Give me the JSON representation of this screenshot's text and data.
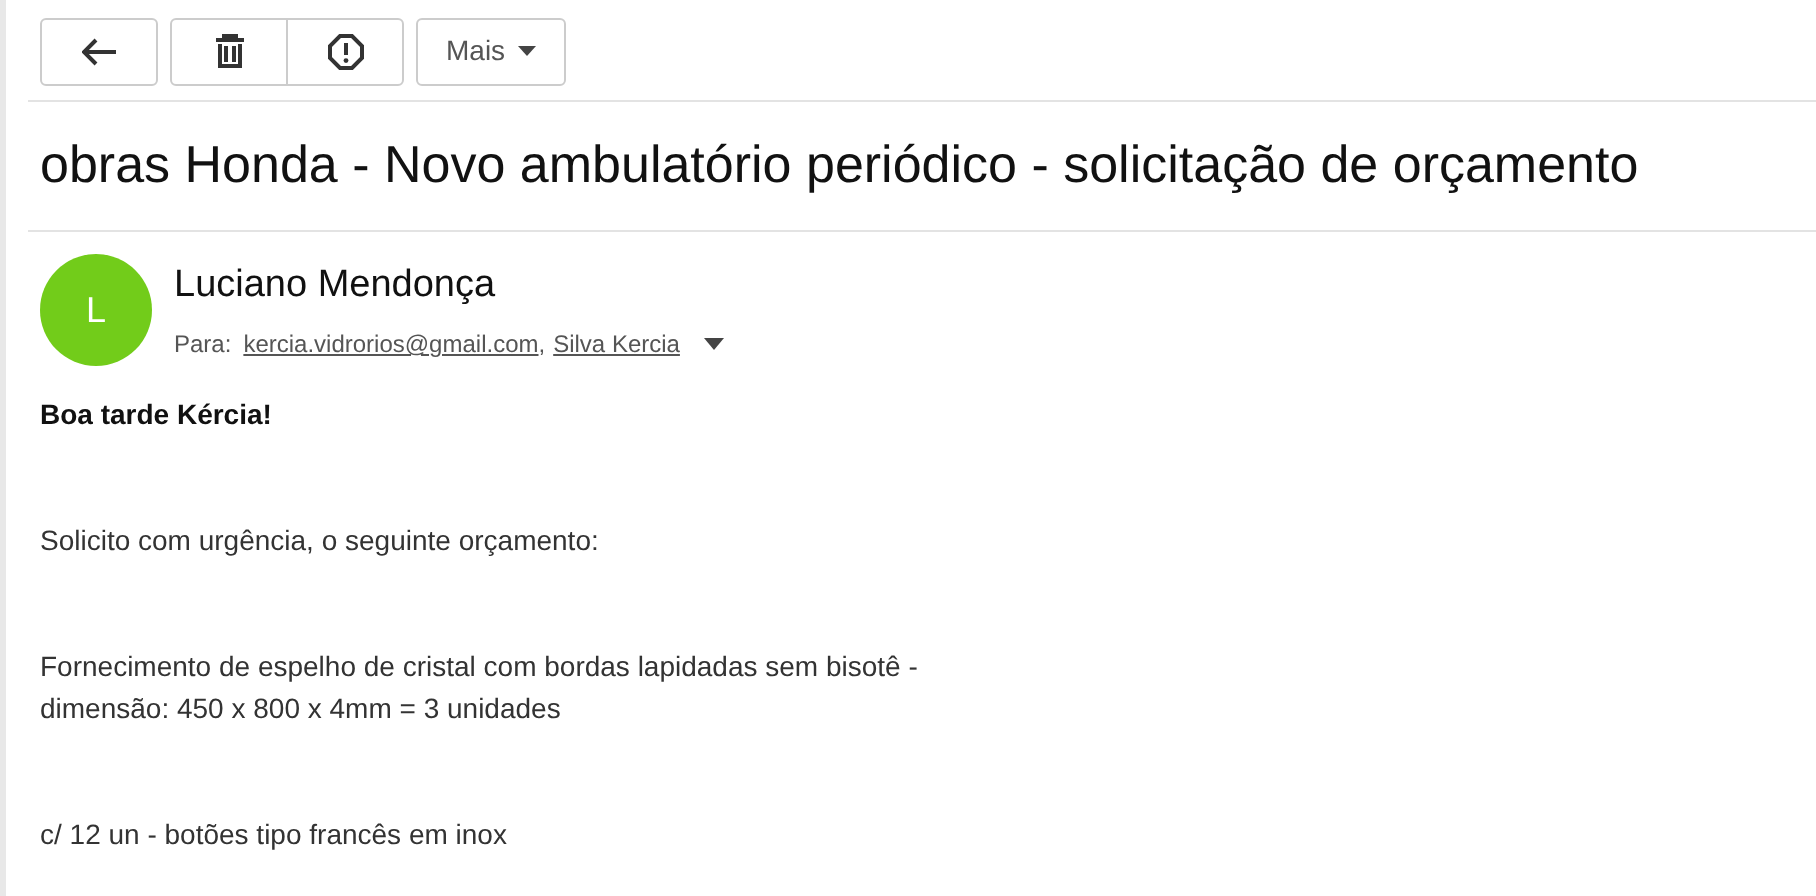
{
  "toolbar": {
    "buttons": [
      {
        "kind": "back"
      },
      {
        "kind": "delete"
      },
      {
        "kind": "spam"
      }
    ],
    "more_button": {
      "label": "Mais"
    }
  },
  "subject": "obras Honda - Novo ambulatório periódico - solicitação de orçamento",
  "sender": {
    "avatar_letter": "L",
    "name": "Luciano Mendonça",
    "to_label": "Para:",
    "recipients": [
      {
        "address": "kercia.vidrorios@gmail.com",
        "separator": ","
      },
      {
        "address": "Silva Kercia"
      }
    ]
  },
  "body": [
    {
      "bold": true,
      "lines": [
        "Boa tarde Kércia!"
      ]
    },
    {
      "bold": false,
      "lines": [
        "Solicito com urgência, o seguinte orçamento:"
      ]
    },
    {
      "bold": false,
      "lines": [
        "Fornecimento de espelho de cristal com bordas lapidadas sem bisotê -",
        "dimensão: 450 x 800 x 4mm = 3 unidades"
      ]
    },
    {
      "bold": false,
      "lines": [
        "c/ 12 un - botões tipo francês em inox"
      ]
    }
  ]
}
